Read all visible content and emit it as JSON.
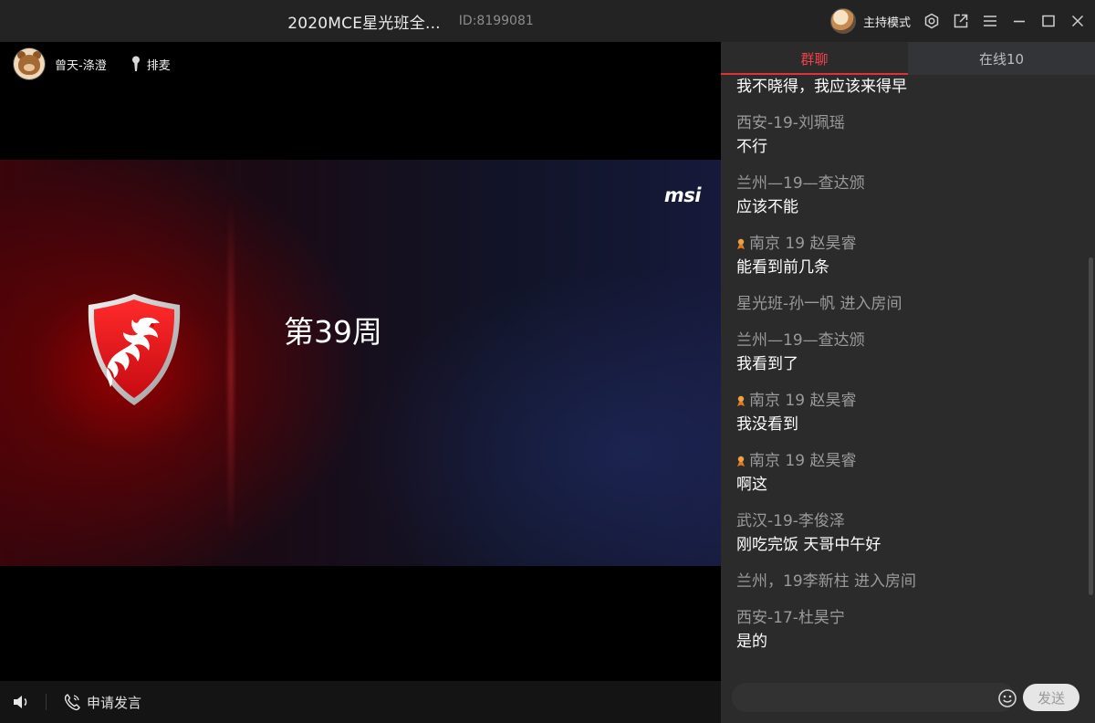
{
  "titlebar": {
    "title": "2020MCE星光班全...",
    "room_id": "ID:8199081",
    "host_mode_label": "主持模式"
  },
  "video": {
    "presenter_name": "曾天-涤澄",
    "mic_queue_label": "排麦",
    "slide": {
      "brand": "msi",
      "title": "第39周"
    },
    "apply_speak_label": "申请发言"
  },
  "chat": {
    "tabs": [
      {
        "label": "群聊",
        "active": true
      },
      {
        "label": "在线10",
        "active": false
      }
    ],
    "messages": [
      {
        "type": "text",
        "sender": "",
        "text": "我不晓得，我应该来得早"
      },
      {
        "type": "text",
        "sender": "西安-19-刘珮瑶",
        "text": "不行"
      },
      {
        "type": "text",
        "sender": "兰州—19—查达颁",
        "text": "应该不能"
      },
      {
        "type": "text",
        "sender": "南京 19 赵昊睿",
        "badge": true,
        "text": "能看到前几条"
      },
      {
        "type": "system",
        "text": "星光班-孙一帆 进入房间"
      },
      {
        "type": "text",
        "sender": "兰州—19—查达颁",
        "text": "我看到了"
      },
      {
        "type": "text",
        "sender": "南京 19 赵昊睿",
        "badge": true,
        "text": "我没看到"
      },
      {
        "type": "text",
        "sender": "南京 19 赵昊睿",
        "badge": true,
        "text": "啊这"
      },
      {
        "type": "text",
        "sender": "武汉-19-李俊泽",
        "text": "刚吃完饭 天哥中午好"
      },
      {
        "type": "system",
        "text": "兰州，19李新柱 进入房间"
      },
      {
        "type": "text",
        "sender": "西安-17-杜昊宁",
        "text": "是的"
      }
    ],
    "input_placeholder": "",
    "send_label": "发送"
  },
  "colors": {
    "accent": "#e0313a",
    "badge": "#f0a040"
  }
}
